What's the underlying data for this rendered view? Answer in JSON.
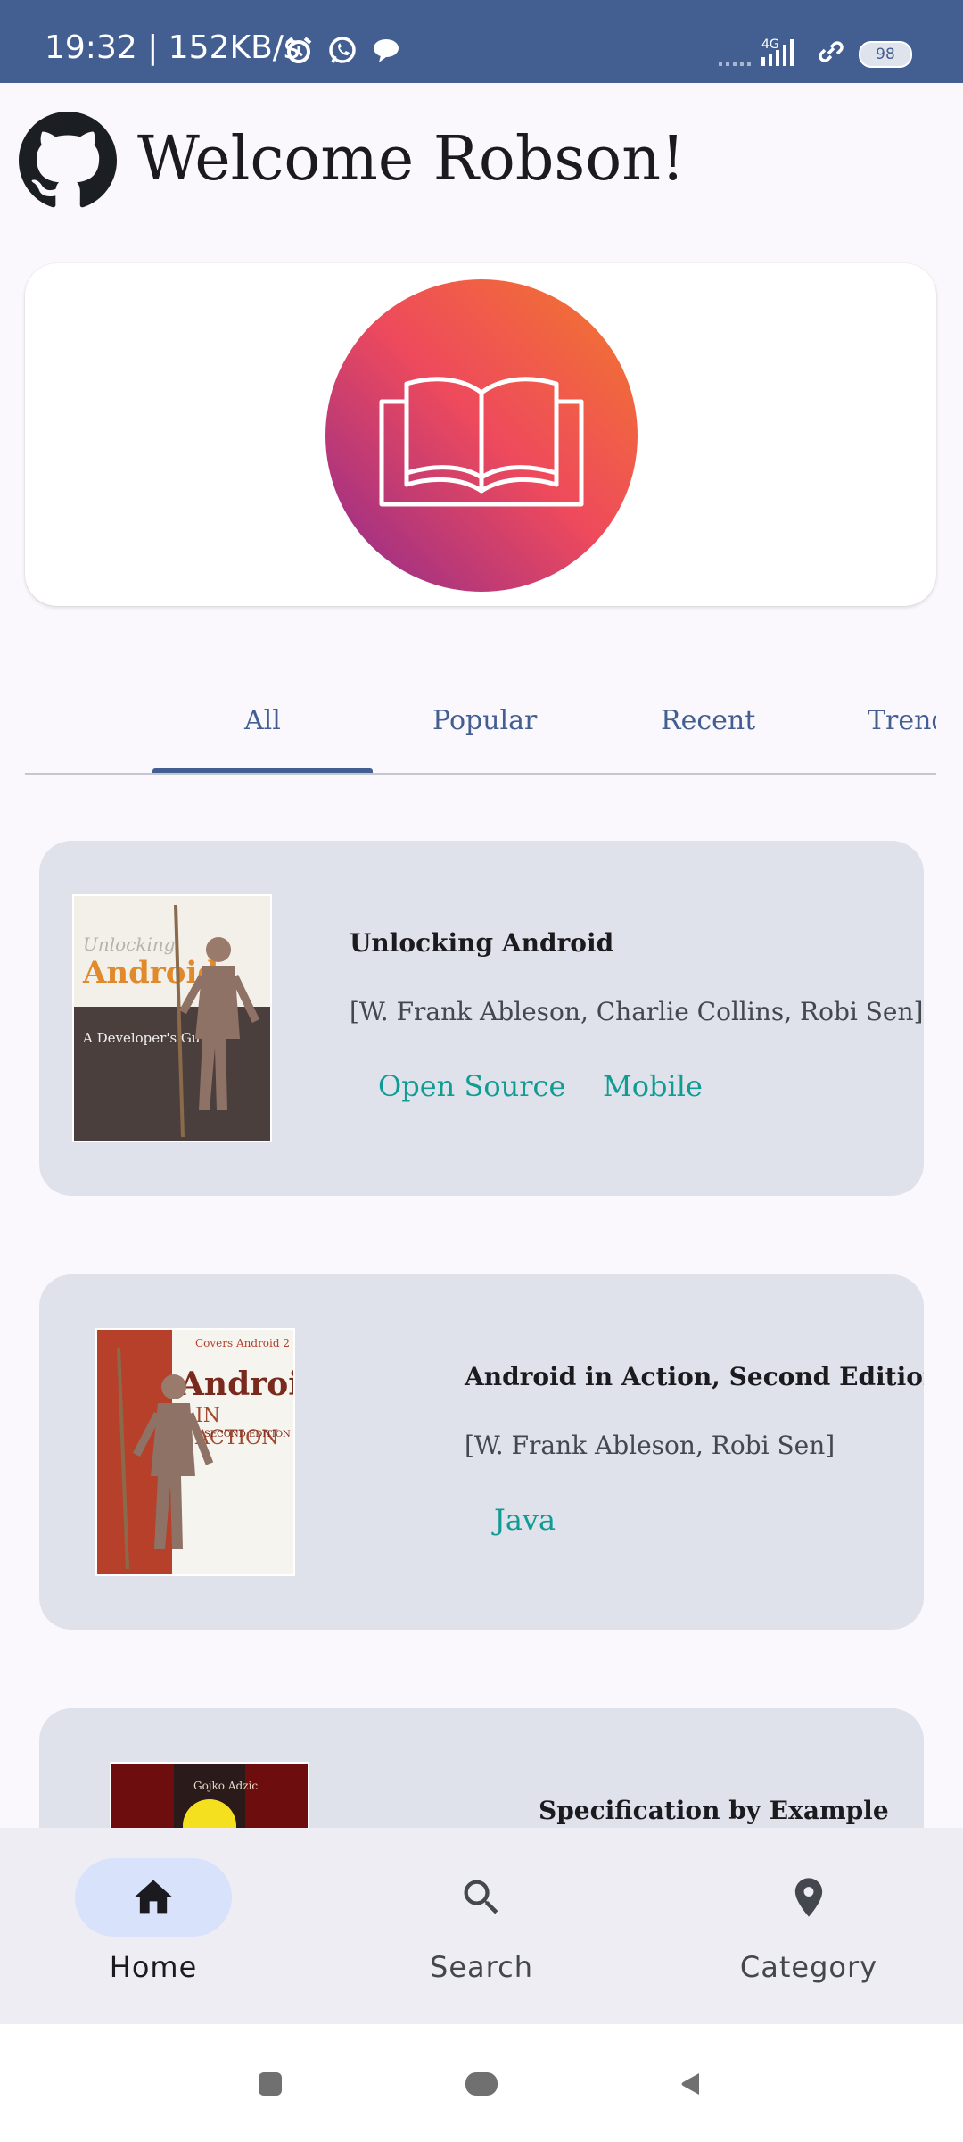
{
  "status_bar": {
    "time_speed": "19:32 | 152KB/s",
    "network_label": "4G",
    "battery_level": "98",
    "icons": [
      "alarm-icon",
      "whatsapp-icon",
      "chat-bubble-icon",
      "signal-icon",
      "link-icon",
      "battery-icon"
    ]
  },
  "header": {
    "logo_icon": "github-icon",
    "welcome_text": "Welcome Robson!"
  },
  "hero": {
    "icon": "open-book-icon",
    "gradient_colors": [
      "#f2792b",
      "#ee4a5c",
      "#8e2a8e"
    ]
  },
  "tabs": {
    "items": [
      {
        "label": "All",
        "selected": true
      },
      {
        "label": "Popular",
        "selected": false
      },
      {
        "label": "Recent",
        "selected": false
      },
      {
        "label": "Trending",
        "selected": false
      }
    ]
  },
  "books": [
    {
      "title": "Unlocking Android",
      "authors": "[W. Frank Ableson, Charlie Collins, Robi Sen]",
      "tags": [
        "Open Source",
        "Mobile"
      ],
      "cover_text": {
        "line1": "Unlocking",
        "line2": "Android",
        "line3": "A Developer's Guide"
      }
    },
    {
      "title": "Android in Action, Second Edition",
      "authors": "[W. Frank Ableson, Robi Sen]",
      "tags": [
        "Java"
      ],
      "cover_text": {
        "line1": "Covers Android 2",
        "line2": "Android",
        "line3": "IN ACTION",
        "line4": "SECOND EDITION"
      }
    },
    {
      "title": "Specification by Example",
      "authors": "",
      "tags": [],
      "cover_text": {
        "line1": "Gojko Adzic"
      }
    }
  ],
  "bottom_nav": {
    "items": [
      {
        "label": "Home",
        "icon": "home-icon",
        "active": true
      },
      {
        "label": "Search",
        "icon": "search-icon",
        "active": false
      },
      {
        "label": "Category",
        "icon": "location-pin-icon",
        "active": false
      }
    ]
  },
  "colors": {
    "primary": "#435f92",
    "tag": "#119c93",
    "card_bg": "#dfe2eb",
    "nav_bg": "#efedf4",
    "nav_pill": "#d8e2fa"
  }
}
